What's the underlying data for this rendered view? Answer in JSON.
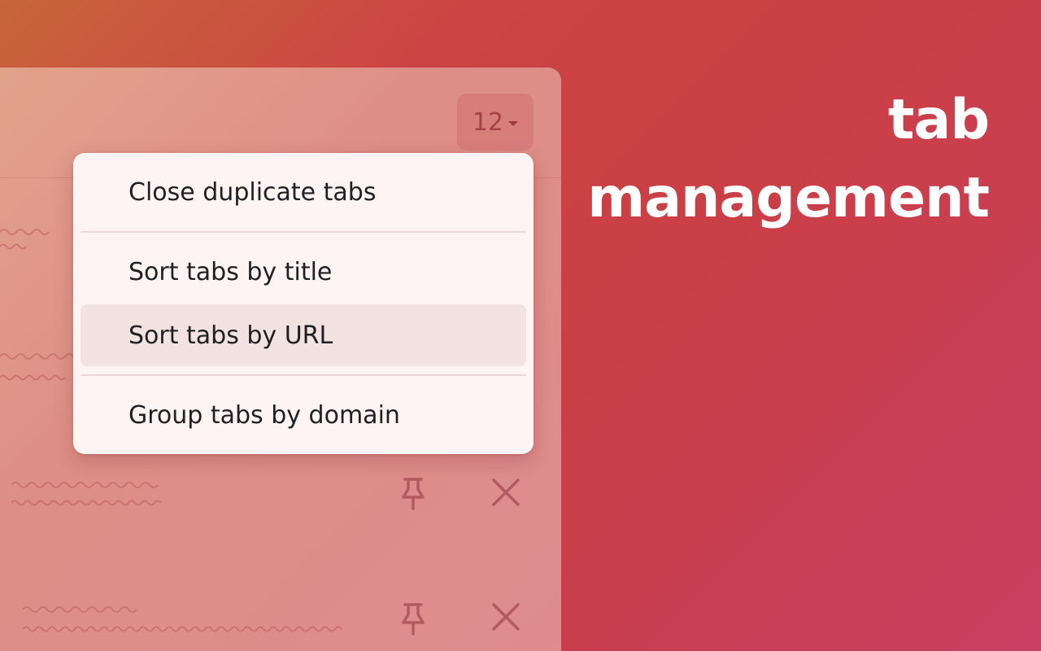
{
  "headline": {
    "line1": "tab",
    "line2": "management"
  },
  "panel": {
    "tab_count": "12"
  },
  "menu": {
    "items": [
      {
        "label": "Close duplicate tabs"
      },
      {
        "label": "Sort tabs by title"
      },
      {
        "label": "Sort tabs by URL",
        "highlighted": true
      },
      {
        "label": "Group tabs by domain"
      }
    ]
  },
  "colors": {
    "background_start": "#c8653a",
    "background_end": "#c83f62",
    "menu_background": "#fdf4f3",
    "menu_highlight": "#f2e2e1",
    "headline_text": "#ffffff"
  },
  "icons": {
    "pin": "pin-icon",
    "close": "close-icon",
    "dropdown": "caret-down-icon"
  }
}
